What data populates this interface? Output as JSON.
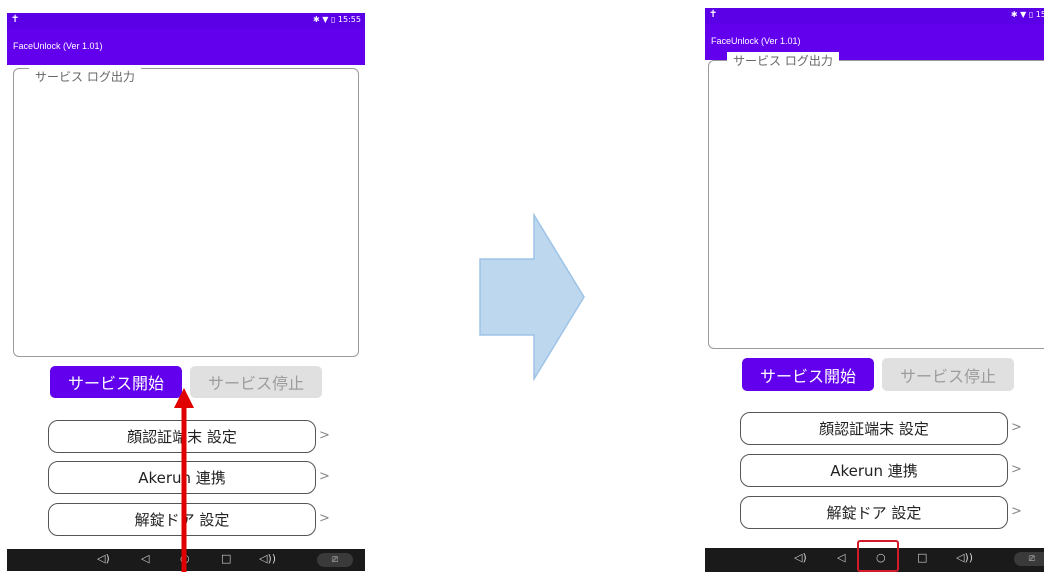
{
  "status": {
    "left_icon": "✝",
    "right_text": "✱ ▼ ▯ 15:55",
    "right_text_cropped": "✱ ▼ ▯ 15"
  },
  "app": {
    "title": "FaceUnlock (Ver 1.01)"
  },
  "log": {
    "legend": "サービス ログ出力"
  },
  "buttons": {
    "start": "サービス開始",
    "stop": "サービス停止"
  },
  "menu": [
    {
      "label": "顔認証端末 設定",
      "chevron": ">"
    },
    {
      "label": "Akerun 連携",
      "chevron": ">"
    },
    {
      "label": "解錠ドア 設定",
      "chevron": ">"
    }
  ],
  "nav": {
    "vol_down": "◁)",
    "back": "◁",
    "home": "○",
    "recent": "□",
    "vol_up": "◁))",
    "screenshot": "⎚"
  },
  "colors": {
    "app_bar": "#6200ee",
    "status_bar": "#5b00e6",
    "arrow_red": "#e00000",
    "big_arrow": "#bdd7ee",
    "highlight_red": "#d11a2a"
  },
  "icons": {
    "transition": "right-arrow-icon",
    "swipe": "up-arrow-icon",
    "home_highlight": "red-box-highlight"
  }
}
